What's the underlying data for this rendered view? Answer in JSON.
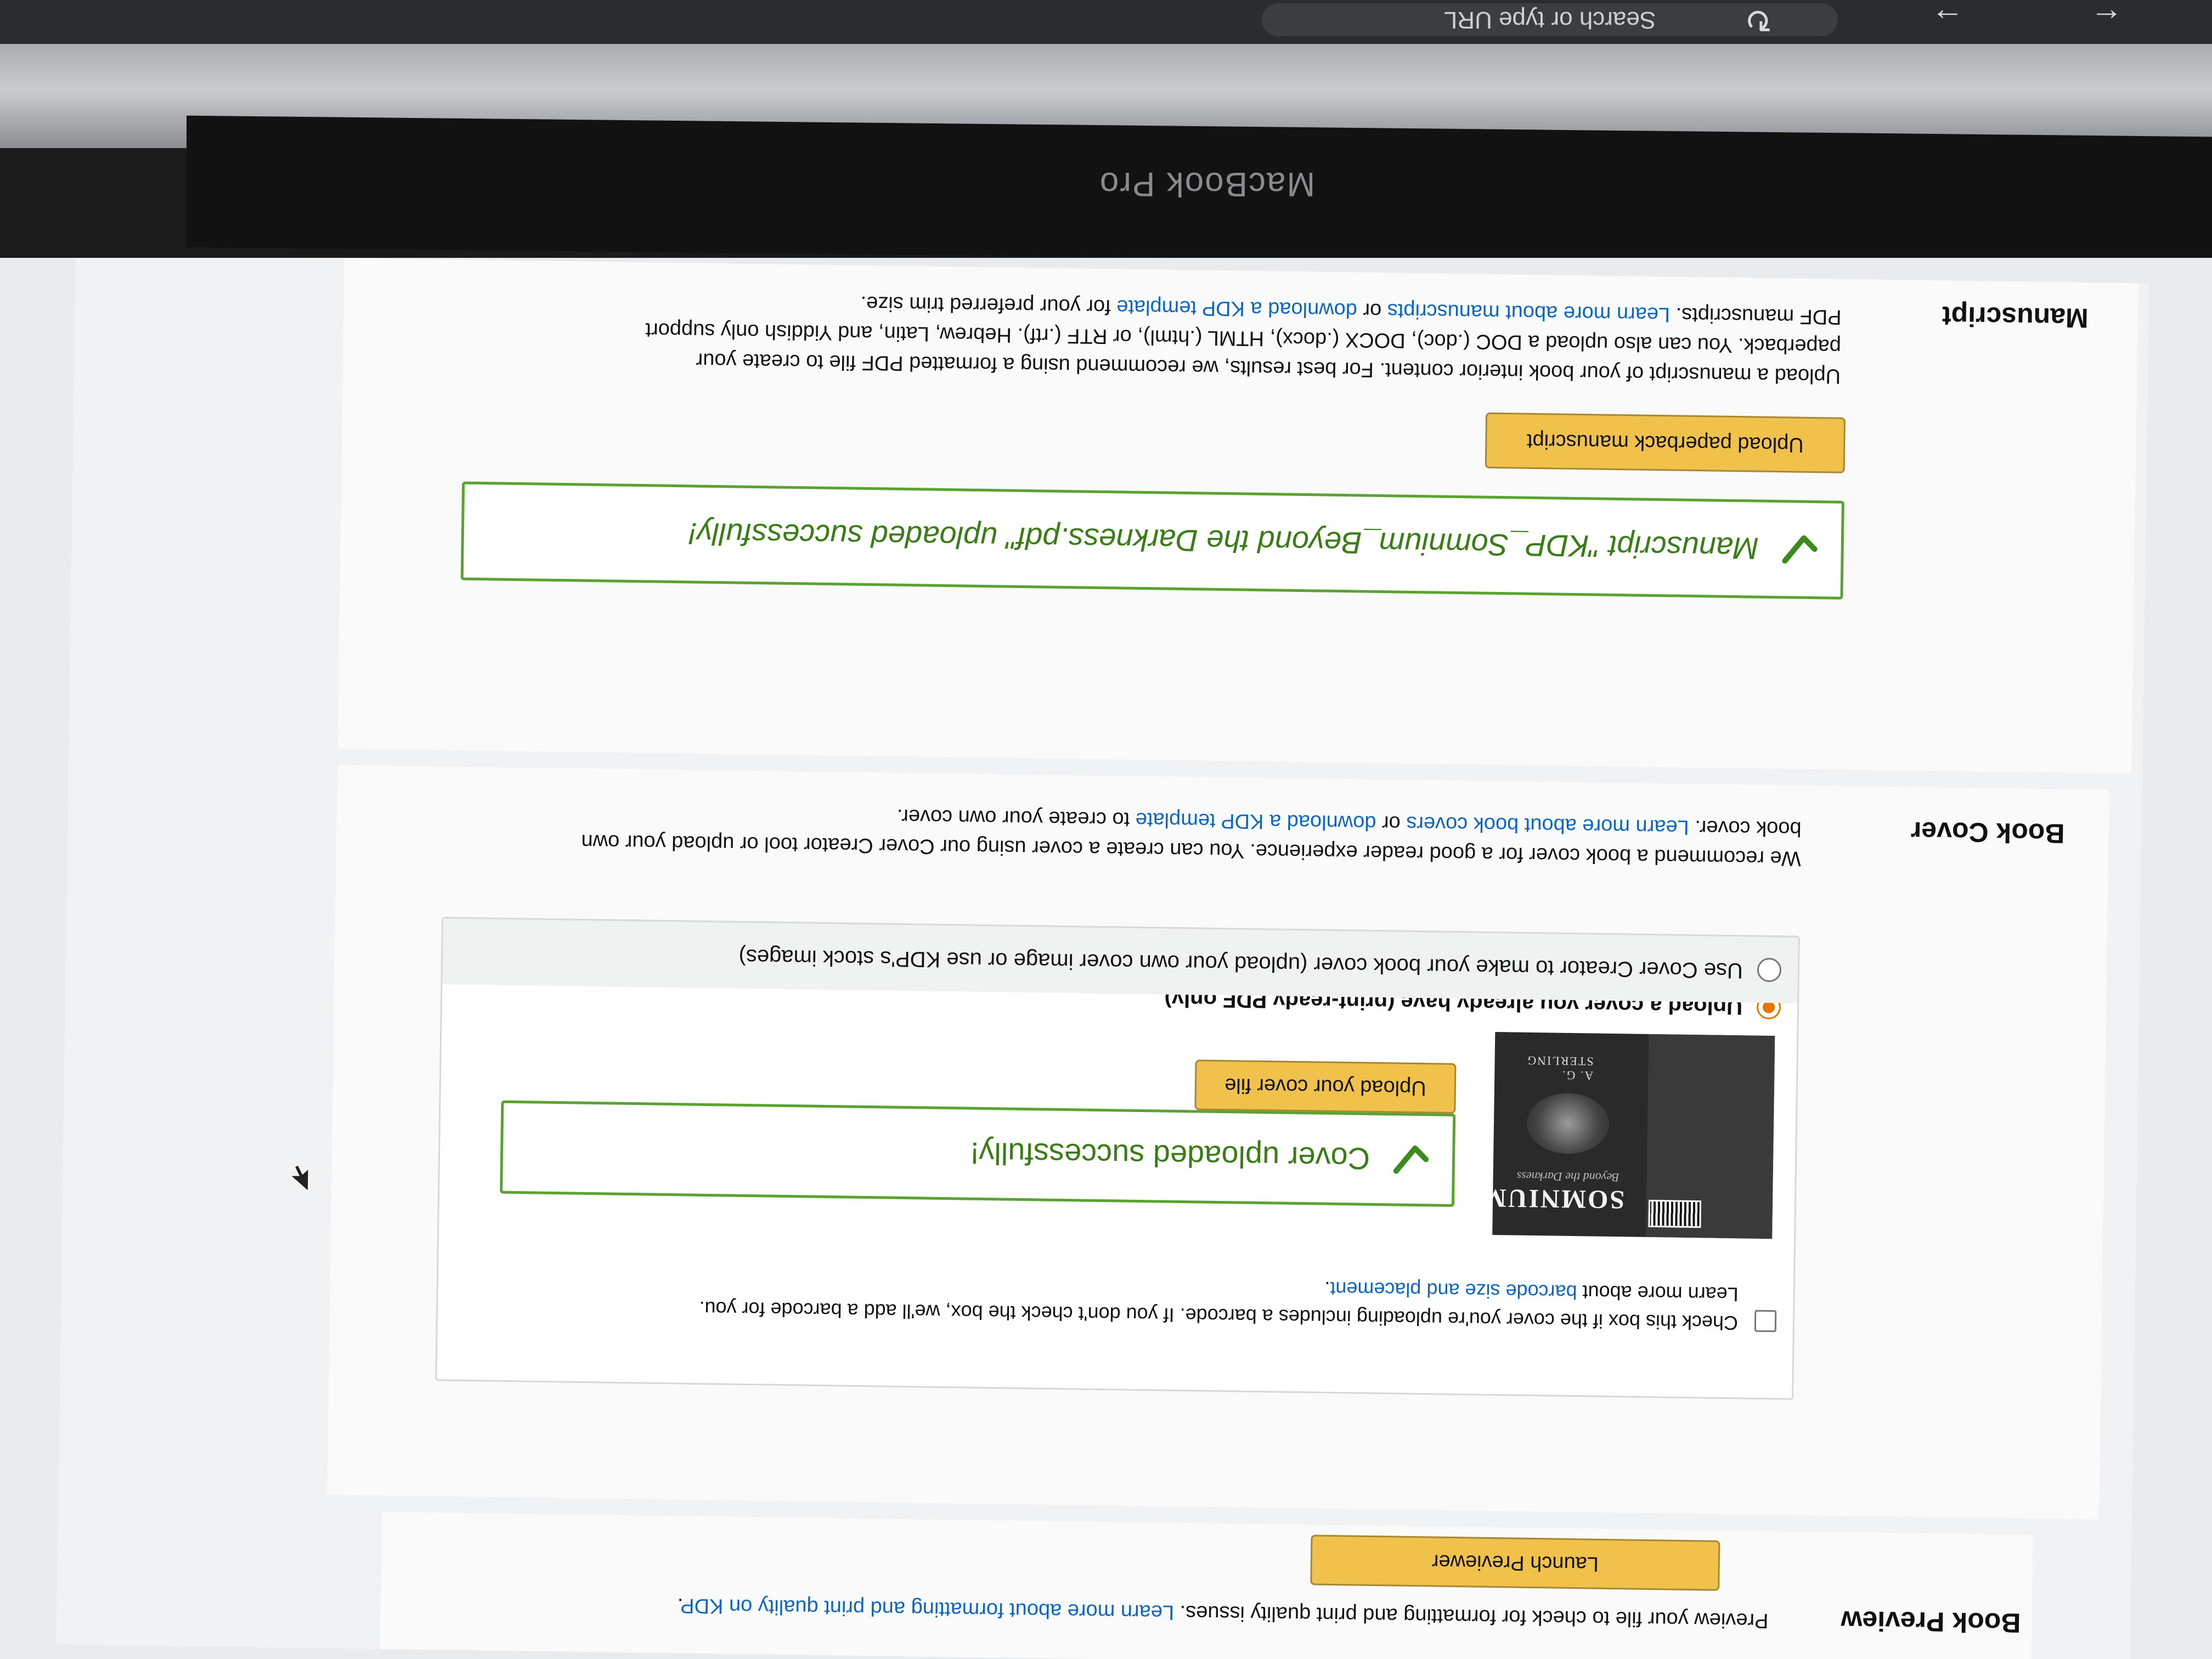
{
  "browser": {
    "address_placeholder": "Search or type URL",
    "back_glyph": "←",
    "forward_glyph": "→",
    "reload_glyph": "↻"
  },
  "device": {
    "label": "MacBook Pro"
  },
  "manuscript": {
    "title": "Manuscript",
    "desc_line1": "Upload a manuscript of your book interior content. For best results, we recommend using a formatted PDF file to create your",
    "desc_line2": "paperback. You can also upload a DOC (.doc), DOCX (.docx), HTML (.html), or RTF (.rtf). Hebrew, Latin, and Yiddish only support",
    "desc_line3_a": "PDF manuscripts. ",
    "desc_line3_link1": "Learn more about manuscripts",
    "desc_line3_b": " or ",
    "desc_line3_link2": "download a KDP template",
    "desc_line3_c": " for your preferred trim size.",
    "upload_button": "Upload paperback manuscript",
    "success_message": "Manuscript \"KDP_Somnium_Beyond the Darkness.pdf\" uploaded successfully!"
  },
  "book_cover": {
    "title": "Book Cover",
    "desc_line1": "We recommend a book cover for a good reader experience. You can create a cover using our Cover Creator tool or upload your own",
    "desc_line2_a": "book cover. ",
    "desc_line2_link1": "Learn more about book covers",
    "desc_line2_b": " or ",
    "desc_line2_link2": "download a KDP template",
    "desc_line2_c": " to create your own cover.",
    "option_creator": "Use Cover Creator to make your book cover (upload your own cover image or use KDP's stock images)",
    "option_upload": "Upload a cover you already have (print-ready PDF only)",
    "upload_button": "Upload your cover file",
    "success_message": "Cover uploaded successfully!",
    "barcode_line1": "Check this box if the cover you're uploading includes a barcode. If you don't check the box, we'll add a barcode for you.",
    "barcode_line2_a": "Learn more about ",
    "barcode_line2_link": "barcode size and placement",
    "barcode_line2_b": ".",
    "thumbnail": {
      "title": "SOMNIUM",
      "subtitle": "Beyond the Darkness",
      "author": "A. G. STERLING"
    }
  },
  "book_preview": {
    "title": "Book Preview",
    "desc_a": "Preview your file to check for formatting and print quality issues. ",
    "desc_link": "Learn more about formatting and print quality on KDP",
    "desc_b": ".",
    "launch_button": "Launch Previewer"
  },
  "colors": {
    "success_green": "#5aa332",
    "button_yellow": "#f0c14b",
    "link_blue": "#0b66c2",
    "radio_orange": "#e77600"
  }
}
